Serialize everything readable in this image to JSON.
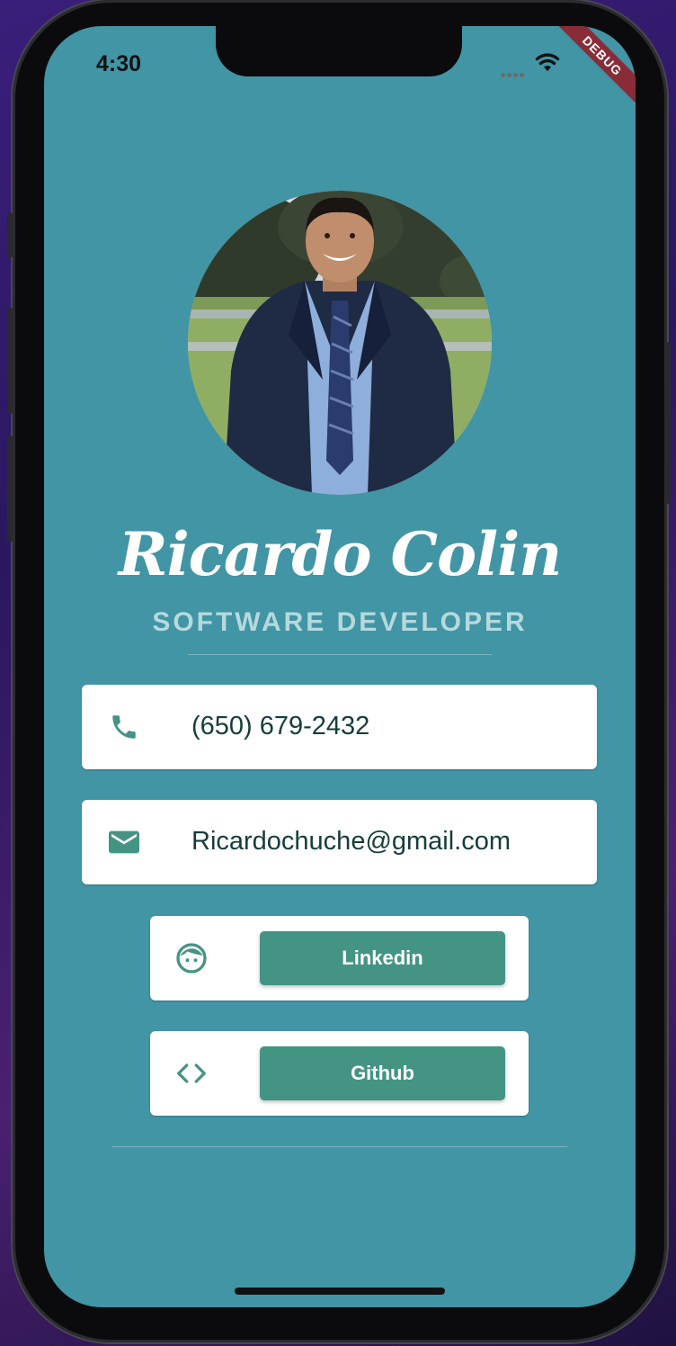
{
  "status_bar": {
    "time": "4:30"
  },
  "debug_banner": "DEBUG",
  "profile": {
    "name": "Ricardo Colin",
    "title": "SOFTWARE DEVELOPER"
  },
  "contacts": {
    "phone": {
      "icon": "phone-icon",
      "text": "(650) 679-2432"
    },
    "email": {
      "icon": "email-icon",
      "text": "Ricardochuche@gmail.com"
    }
  },
  "links": {
    "linkedin": {
      "icon": "face-icon",
      "label": "Linkedin"
    },
    "github": {
      "icon": "code-icon",
      "label": "Github"
    }
  },
  "colors": {
    "background": "#4195a5",
    "accent_button": "#449484",
    "card": "#ffffff",
    "icon": "#449484"
  }
}
